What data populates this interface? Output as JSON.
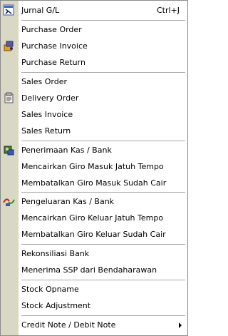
{
  "menu": {
    "items": [
      {
        "label": "Jurnal G/L",
        "shortcut": "Ctrl+J",
        "icon": "journal-icon"
      },
      {
        "label": "Purchase Order"
      },
      {
        "label": "Purchase Invoice",
        "icon": "purchase-invoice-icon"
      },
      {
        "label": "Purchase Return"
      },
      {
        "label": "Sales Order"
      },
      {
        "label": "Delivery Order",
        "icon": "delivery-order-icon"
      },
      {
        "label": "Sales Invoice"
      },
      {
        "label": "Sales Return"
      },
      {
        "label": "Penerimaan Kas / Bank",
        "icon": "cash-receipt-icon"
      },
      {
        "label": "Mencairkan Giro Masuk Jatuh Tempo"
      },
      {
        "label": "Membatalkan Giro Masuk Sudah Cair"
      },
      {
        "label": "Pengeluaran Kas / Bank",
        "icon": "cash-payment-icon"
      },
      {
        "label": "Mencairkan Giro Keluar Jatuh Tempo"
      },
      {
        "label": "Membatalkan Giro Keluar Sudah Cair"
      },
      {
        "label": "Rekonsiliasi Bank"
      },
      {
        "label": "Menerima SSP dari Bendaharawan"
      },
      {
        "label": "Stock Opname"
      },
      {
        "label": "Stock Adjustment"
      },
      {
        "label": "Credit Note / Debit Note",
        "submenu": true
      }
    ]
  },
  "colors": {
    "gutter": "#d9d8c4",
    "separator": "#a8a8a8",
    "border": "#8a8a8a"
  }
}
